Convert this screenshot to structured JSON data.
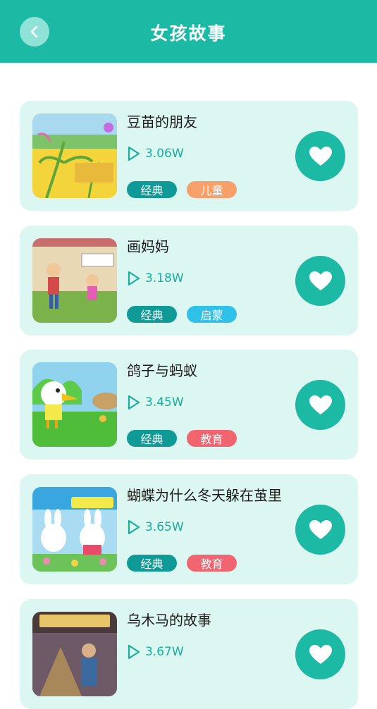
{
  "header": {
    "title": "女孩故事",
    "back_icon": "chevron-left-icon"
  },
  "colors": {
    "primary": "#1cb9a4",
    "card_bg": "#dcf6f1",
    "tag_classic": "#0f9a97",
    "tag_children": "#f8a06a",
    "tag_enlighten": "#2fc1e8",
    "tag_education": "#f06570"
  },
  "stories": [
    {
      "title": "豆苗的朋友",
      "plays": "3.06W",
      "tags": [
        {
          "label": "经典"
        },
        {
          "label": "儿童"
        }
      ]
    },
    {
      "title": "画妈妈",
      "plays": "3.18W",
      "tags": [
        {
          "label": "经典"
        },
        {
          "label": "启蒙"
        }
      ]
    },
    {
      "title": "鸽子与蚂蚁",
      "plays": "3.45W",
      "tags": [
        {
          "label": "经典"
        },
        {
          "label": "教育"
        }
      ]
    },
    {
      "title": "蝴蝶为什么冬天躲在茧里",
      "plays": "3.65W",
      "tags": [
        {
          "label": "经典"
        },
        {
          "label": "教育"
        }
      ]
    },
    {
      "title": "乌木马的故事",
      "plays": "3.67W",
      "tags": []
    }
  ],
  "icons": {
    "play": "play-icon",
    "favorite": "heart-icon"
  }
}
